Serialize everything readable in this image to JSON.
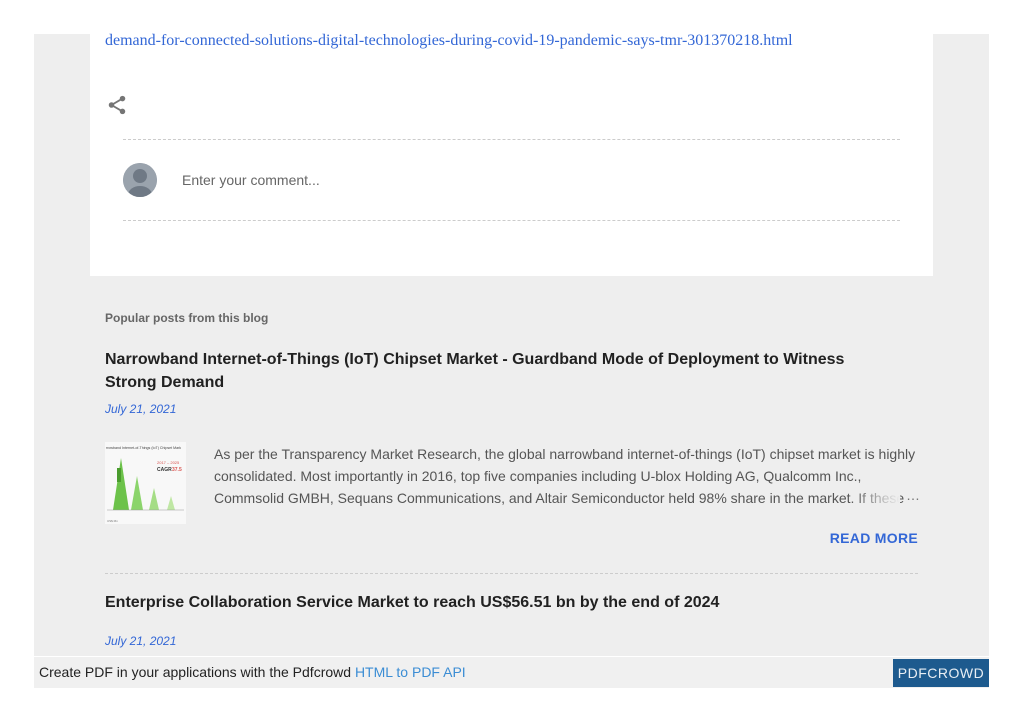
{
  "post": {
    "link_text": "demand-for-connected-solutions-digital-technologies-during-covid-19-pandemic-says-tmr-301370218.html"
  },
  "comment": {
    "placeholder": "Enter your comment..."
  },
  "popular": {
    "heading": "Popular posts from this blog",
    "posts": [
      {
        "title": "Narrowband Internet-of-Things (IoT) Chipset Market - Guardband Mode of Deployment to Witness Strong Demand",
        "date": "July 21, 2021",
        "snippet": "As per the Transparency Market Research, the global narrowband internet-of-things (IoT) chipset market is highly consolidated. Most importantly in 2016, top five companies including U-blox Holding AG, Qualcomm Inc., Commsolid GMBH, Sequans Communications, and Altair Semiconductor held 98% share in the market. If these",
        "ellipsis": "…",
        "read_more": "READ MORE",
        "thumb_title": "rrowband Internet-of-Things (IoT) Chipset Mark",
        "thumb_years": "2017 – 2025",
        "thumb_cagr": "CAGR",
        "thumb_cagr_value": "37.5",
        "thumb_bar_label": "US$ Mn"
      },
      {
        "title": "Enterprise Collaboration Service Market to reach US$56.51 bn by the end of 2024",
        "date": "July 21, 2021"
      }
    ]
  },
  "footer": {
    "text": "Create PDF in your applications with the Pdfcrowd ",
    "link": "HTML to PDF API",
    "button": "PDFCROWD"
  },
  "colors": {
    "link": "#3367d6",
    "page_background": "#eeeeee",
    "pdf_button": "#1d5a8e"
  }
}
